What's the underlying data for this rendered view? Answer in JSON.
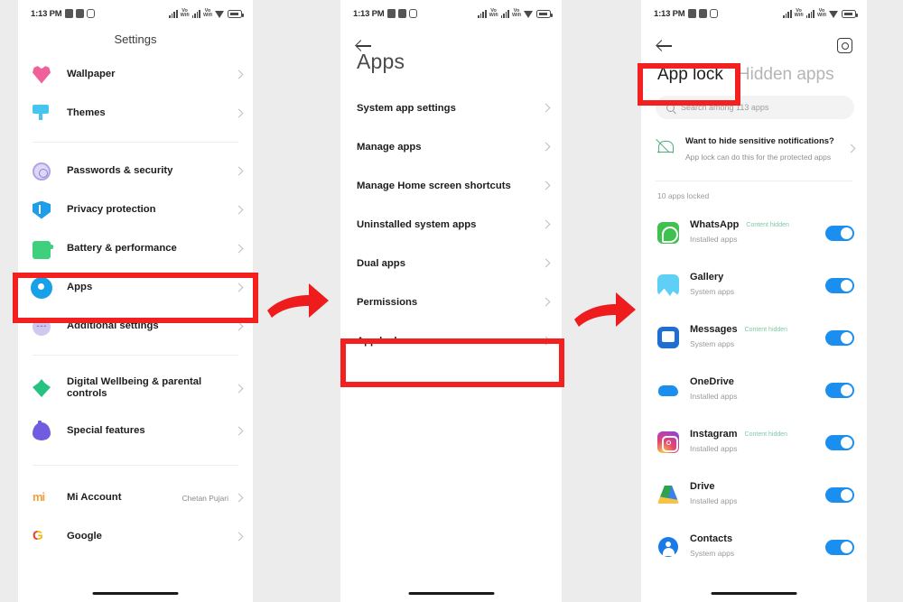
{
  "statusbar": {
    "time": "1:13 PM",
    "icons": [
      "calculator-icon",
      "sim-icon",
      "instagram-icon"
    ],
    "right_icons": [
      "signal-bars-icon",
      "volte-icon",
      "signal-bars-icon",
      "volte-icon",
      "wifi-icon",
      "battery-icon"
    ],
    "volte_label": "Vo\nWifi"
  },
  "panel1": {
    "title": "Settings",
    "groups": [
      {
        "items": [
          {
            "label": "Wallpaper",
            "icon": "wallpaper-icon",
            "value": ""
          },
          {
            "label": "Themes",
            "icon": "themes-icon",
            "value": ""
          }
        ]
      },
      {
        "items": [
          {
            "label": "Passwords & security",
            "icon": "fingerprint-icon",
            "value": ""
          },
          {
            "label": "Privacy protection",
            "icon": "shield-icon",
            "value": ""
          },
          {
            "label": "Battery & performance",
            "icon": "battery-icon",
            "value": ""
          },
          {
            "label": "Apps",
            "icon": "gear-icon",
            "value": ""
          },
          {
            "label": "Additional settings",
            "icon": "dots-icon",
            "value": ""
          }
        ]
      },
      {
        "items": [
          {
            "label": "Digital Wellbeing & parental controls",
            "icon": "wellbeing-icon",
            "value": ""
          },
          {
            "label": "Special features",
            "icon": "special-features-icon",
            "value": ""
          }
        ]
      },
      {
        "items": [
          {
            "label": "Mi Account",
            "icon": "mi-logo-icon",
            "value": "Chetan Pujari"
          },
          {
            "label": "Google",
            "icon": "google-logo-icon",
            "value": ""
          }
        ]
      }
    ]
  },
  "panel2": {
    "title": "Apps",
    "back_icon": "back-arrow-icon",
    "items": [
      {
        "label": "System app settings"
      },
      {
        "label": "Manage apps"
      },
      {
        "label": "Manage Home screen shortcuts"
      },
      {
        "label": "Uninstalled system apps"
      },
      {
        "label": "Dual apps"
      },
      {
        "label": "Permissions"
      },
      {
        "label": "App lock"
      }
    ]
  },
  "panel3": {
    "back_icon": "back-arrow-icon",
    "settings_icon": "gear-icon",
    "tabs": [
      {
        "label": "App lock",
        "active": true
      },
      {
        "label": "Hidden apps",
        "active": false
      }
    ],
    "search": {
      "placeholder": "Search among 113 apps",
      "icon": "search-icon"
    },
    "notification_card": {
      "icon": "bell-off-icon",
      "title": "Want to hide sensitive notifications?",
      "subtitle": "App lock can do this for the protected apps"
    },
    "locked_count": "10 apps locked",
    "apps": [
      {
        "name": "WhatsApp",
        "badge": "Content hidden",
        "category": "Installed apps",
        "icon": "whatsapp-icon",
        "toggle": "on"
      },
      {
        "name": "Gallery",
        "badge": "",
        "category": "System apps",
        "icon": "gallery-icon",
        "toggle": "on"
      },
      {
        "name": "Messages",
        "badge": "Content hidden",
        "category": "System apps",
        "icon": "messages-icon",
        "toggle": "on"
      },
      {
        "name": "OneDrive",
        "badge": "",
        "category": "Installed apps",
        "icon": "onedrive-icon",
        "toggle": "on"
      },
      {
        "name": "Instagram",
        "badge": "Content hidden",
        "category": "Installed apps",
        "icon": "instagram-icon",
        "toggle": "on"
      },
      {
        "name": "Drive",
        "badge": "",
        "category": "Installed apps",
        "icon": "google-drive-icon",
        "toggle": "on"
      },
      {
        "name": "Contacts",
        "badge": "",
        "category": "System apps",
        "icon": "contacts-icon",
        "toggle": "on"
      }
    ]
  },
  "annotations": {
    "highlight_color": "#f41f1f",
    "arrow_color": "#ee1c1c",
    "arrows": [
      "step-arrow-1",
      "step-arrow-2"
    ],
    "highlights": [
      "apps-row-highlight",
      "app-lock-row-highlight",
      "app-lock-tab-highlight"
    ]
  }
}
